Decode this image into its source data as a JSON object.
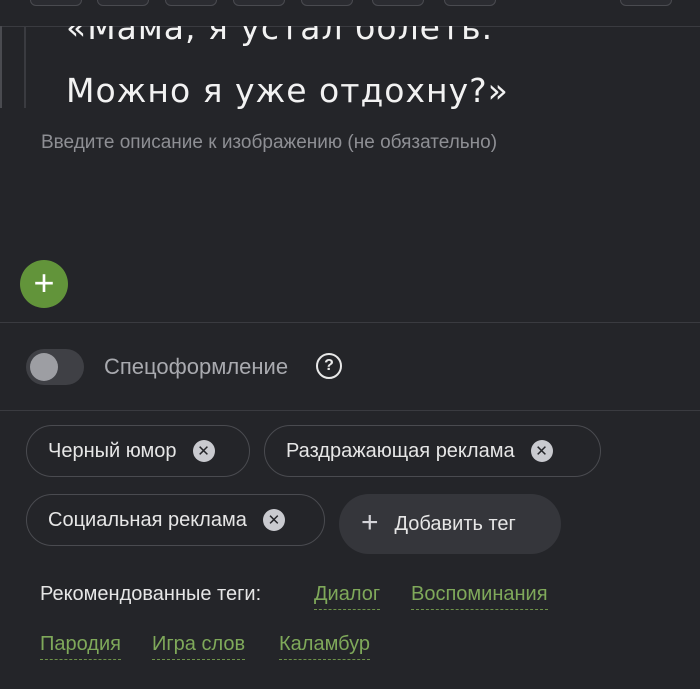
{
  "image": {
    "line1": "«Мама, я устал болеть.",
    "line2": "Можно я уже отдохну?»"
  },
  "caption_placeholder": "Введите описание к изображению (не обязательно)",
  "add_block_icon": "plus-icon",
  "special_formatting": {
    "label": "Спецоформление",
    "enabled": false,
    "help_icon": "question-circle-icon",
    "help_glyph": "?"
  },
  "tags": [
    {
      "label": "Черный юмор",
      "remove_icon": "close-circle-icon"
    },
    {
      "label": "Раздражающая реклама",
      "remove_icon": "close-circle-icon"
    },
    {
      "label": "Социальная реклама",
      "remove_icon": "close-circle-icon"
    }
  ],
  "add_tag": {
    "label": "Добавить тег",
    "icon": "plus-icon"
  },
  "recommended": {
    "label": "Рекомендованные теги:",
    "tags": [
      "Диалог",
      "Воспоминания",
      "Пародия",
      "Игра слов",
      "Каламбур"
    ]
  },
  "colors": {
    "background": "#242529",
    "accent_green": "#62943a",
    "recommended_tag": "#7fa95a"
  }
}
